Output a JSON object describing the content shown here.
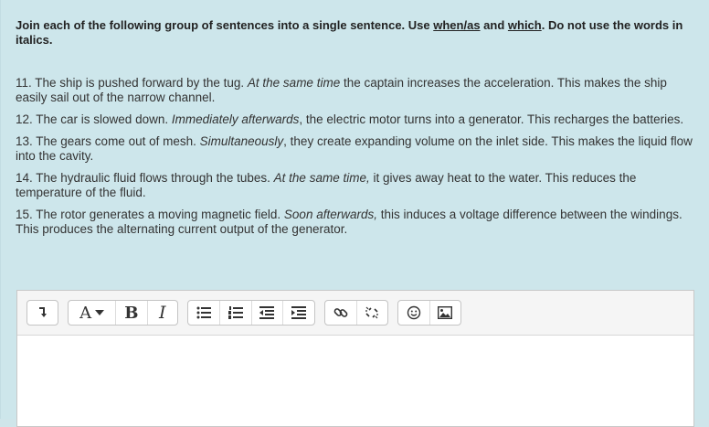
{
  "instructions": {
    "part1": "Join each of the following group of sentences into a single sentence. Use ",
    "link1": "when/as",
    "part2": " and ",
    "link2": "which",
    "part3": ". Do not use the words in italics."
  },
  "questions": [
    {
      "pre": "11. The ship is pushed forward by the tug. ",
      "italic": "At the same time",
      "post": " the captain increases the acceleration. This makes the ship easily sail out of the narrow channel."
    },
    {
      "pre": "12. The car is slowed down. ",
      "italic": "Immediately afterwards",
      "post": ", the electric motor turns into a generator. This recharges the batteries."
    },
    {
      "pre": "13. The gears come out of mesh. ",
      "italic": "Simultaneously",
      "post": ", they create expanding volume on the inlet side. This makes the liquid flow into the cavity."
    },
    {
      "pre": "14.  The hydraulic fluid flows through the tubes. ",
      "italic": "At the same time,",
      "post": " it gives away heat to the water. This reduces the temperature of the fluid."
    },
    {
      "pre": "15. The rotor generates a moving magnetic field. ",
      "italic": "Soon afterwards,",
      "post": " this induces a voltage difference between the windings. This produces the alternating current output of the generator."
    }
  ],
  "toolbar": {
    "font_label": "A",
    "bold_label": "B",
    "italic_label": "I"
  },
  "editor": {
    "content": ""
  }
}
